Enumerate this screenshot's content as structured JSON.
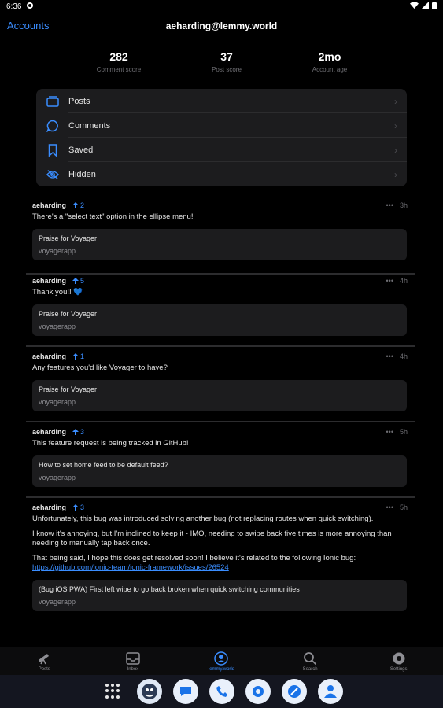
{
  "status": {
    "time": "6:36"
  },
  "header": {
    "back_label": "Accounts",
    "title": "aeharding@lemmy.world"
  },
  "scores": [
    {
      "value": "282",
      "label": "Comment score"
    },
    {
      "value": "37",
      "label": "Post score"
    },
    {
      "value": "2mo",
      "label": "Account age"
    }
  ],
  "menu": [
    {
      "label": "Posts",
      "icon": "posts-icon"
    },
    {
      "label": "Comments",
      "icon": "comments-icon"
    },
    {
      "label": "Saved",
      "icon": "bookmark-icon"
    },
    {
      "label": "Hidden",
      "icon": "eye-off-icon"
    }
  ],
  "comments": [
    {
      "author": "aeharding",
      "score": "2",
      "age": "3h",
      "body": [
        "There's a \"select text\" option in the ellipse menu!"
      ],
      "post_title": "Praise for Voyager",
      "post_community": "voyagerapp"
    },
    {
      "author": "aeharding",
      "score": "5",
      "age": "4h",
      "body": [
        "Thank you!! 💙"
      ],
      "post_title": "Praise for Voyager",
      "post_community": "voyagerapp"
    },
    {
      "author": "aeharding",
      "score": "1",
      "age": "4h",
      "body": [
        "Any features you'd like Voyager to have?"
      ],
      "post_title": "Praise for Voyager",
      "post_community": "voyagerapp"
    },
    {
      "author": "aeharding",
      "score": "3",
      "age": "5h",
      "body": [
        "This feature request is being tracked in GitHub!"
      ],
      "post_title": "How to set home feed to be default feed?",
      "post_community": "voyagerapp"
    },
    {
      "author": "aeharding",
      "score": "3",
      "age": "5h",
      "body": [
        "Unfortunately, this bug was introduced solving another bug (not replacing routes when quick switching).",
        "I know it's annoying, but I'm inclined to keep it - IMO, needing to swipe back five times is more annoying than needing to manually tap back once.",
        "That being said, I hope this does get resolved soon! I believe it's related to the following Ionic bug:"
      ],
      "link": "https://github.com/ionic-team/ionic-framework/issues/26524",
      "post_title": "(Bug iOS PWA) First left wipe to go back broken when quick switching communities",
      "post_community": "voyagerapp"
    }
  ],
  "tabs": [
    {
      "label": "Posts",
      "icon": "telescope-icon"
    },
    {
      "label": "Inbox",
      "icon": "inbox-icon"
    },
    {
      "label": "lemmy.world",
      "icon": "person-circle-icon",
      "active": true
    },
    {
      "label": "Search",
      "icon": "search-icon"
    },
    {
      "label": "Settings",
      "icon": "gear-icon"
    }
  ],
  "dock": [
    "apps-grid-icon",
    "voyager-app-icon",
    "messages-app-icon",
    "phone-app-icon",
    "settings-app-icon",
    "pen-app-icon",
    "contacts-app-icon"
  ],
  "colors": {
    "accent": "#3a8dff",
    "card": "#1c1c1e",
    "background": "#000000"
  }
}
